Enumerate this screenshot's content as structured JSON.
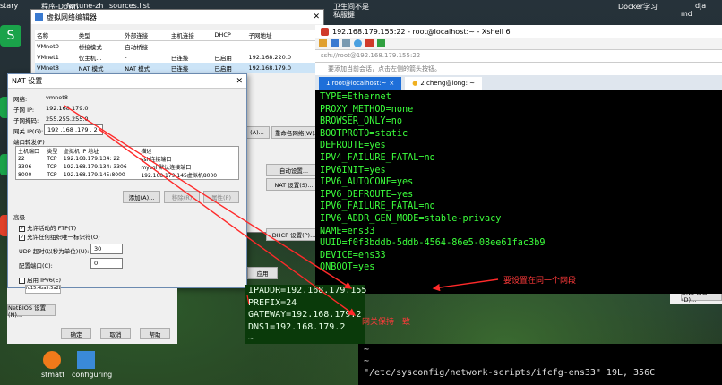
{
  "desktop": {
    "top_left_items": [
      "stary",
      "程序-Down",
      "fortune-zh",
      "sources.list"
    ],
    "top_right_items": [
      "卫生间不是",
      "私服键",
      "Docker学习",
      "dja",
      "md"
    ],
    "left_icons": [
      "S",
      "S",
      "S",
      "S"
    ],
    "taskbar_labels": [
      "stmatf",
      "configuring"
    ]
  },
  "vnet_editor": {
    "title": "虚拟网络编辑器",
    "columns": [
      "名称",
      "类型",
      "外部连接",
      "主机连接",
      "DHCP",
      "子网地址"
    ],
    "rows": [
      [
        "VMnet0",
        "桥接模式",
        "自动桥接",
        "-",
        "-",
        "-"
      ],
      [
        "VMnet1",
        "仅主机...",
        "-",
        "已连接",
        "已启用",
        "192.168.220.0"
      ],
      [
        "VMnet8",
        "NAT 模式",
        "NAT 模式",
        "已连接",
        "已启用",
        "192.168.179.0"
      ]
    ],
    "buttons": {
      "add": "(A)...",
      "remove": "移除网络(O)",
      "rename": "重命名网络(W)...",
      "auto": "自动设置...",
      "nat_settings": "NAT 设置(S)...",
      "dhcp_settings": "DHCP 设置(P)...",
      "apply": "应用"
    }
  },
  "nat_dialog": {
    "title": "NAT 设置",
    "network_label": "网络:",
    "network_value": "vmnet8",
    "subnet_ip_label": "子网 IP:",
    "subnet_ip_value": "192.168.179.0",
    "subnet_mask_label": "子网掩码:",
    "subnet_mask_value": "255.255.255.0",
    "gateway_label": "网关 IP(G):",
    "gateway_value": "192 .168 .179 . 2",
    "port_forward_label": "端口转发(F)",
    "pf_columns": [
      "主机端口",
      "类型",
      "虚拟机 IP 地址",
      "描述"
    ],
    "pf_rows": [
      [
        "22",
        "TCP",
        "192.168.179.134: 22",
        "ssh连接端口"
      ],
      [
        "3306",
        "TCP",
        "192.168.179.134: 3306",
        "mysql 默认连接端口"
      ],
      [
        "8000",
        "TCP",
        "192.168.179.145:8000",
        "192.168.179.145虚拟机8000"
      ]
    ],
    "btn_add": "添加(A)...",
    "btn_remove": "移除(R)",
    "btn_props": "属性(P)",
    "advanced_label": "高级",
    "chk_ftp": "允许活动的 FTP(T)",
    "chk_uuid": "允许任何组织唯一标识符(O)",
    "udp_label": "UDP 超时(以秒为单位)(U):",
    "udp_value": "30",
    "config_port_label": "配置端口(C):",
    "config_port_value": "0",
    "ipv6_label": "启用 IPv6(E)",
    "ipv6_prefix": "fd15:4ba5:5a2b:1008::/64",
    "dns_button": "DNS 设置(D)...",
    "netbios_button": "NetBIOS 设置(N)...",
    "btn_ok": "确定",
    "btn_cancel": "取消",
    "btn_help": "帮助"
  },
  "xshell": {
    "title": "192.168.179.155:22 - root@localhost:~ - Xshell 6",
    "address": "ssh://root@192.168.179.155:22",
    "hint": "要添加当前会话，点击左侧的箭头按钮。",
    "tabs": [
      {
        "label": "1 root@localhost:~",
        "active": true
      },
      {
        "label": "2 cheng@long: ~",
        "active": false
      }
    ],
    "lines": [
      "TYPE=Ethernet",
      "PROXY_METHOD=none",
      "BROWSER_ONLY=no",
      "BOOTPROTO=static",
      "DEFROUTE=yes",
      "IPV4_FAILURE_FATAL=no",
      "IPV6INIT=yes",
      "IPV6_AUTOCONF=yes",
      "IPV6_DEFROUTE=yes",
      "IPV6_FAILURE_FATAL=no",
      "IPV6_ADDR_GEN_MODE=stable-privacy",
      "NAME=ens33",
      "UUID=f0f3bddb-5ddb-4564-86e5-08ee61fac3b9",
      "DEVICE=ens33",
      "ONBOOT=yes"
    ],
    "mid_lines": [
      "IPADDR=192.168.179.155",
      "PREFIX=24",
      "GATEWAY=192.168.179.2",
      "DNS1=192.168.179.2",
      "~"
    ],
    "bottom_lines": [
      "~",
      "~",
      "\"/etc/sysconfig/network-scripts/ifcfg-ens33\" 19L, 356C"
    ]
  },
  "annotations": {
    "same_segment": "要设置在同一个网段",
    "gateway_consistent": "网关保持一致"
  },
  "colors": {
    "terminal_green": "#3cff3c",
    "annotation_red": "#ff3a3a",
    "xshell_tab_active": "#1e6fd9"
  }
}
